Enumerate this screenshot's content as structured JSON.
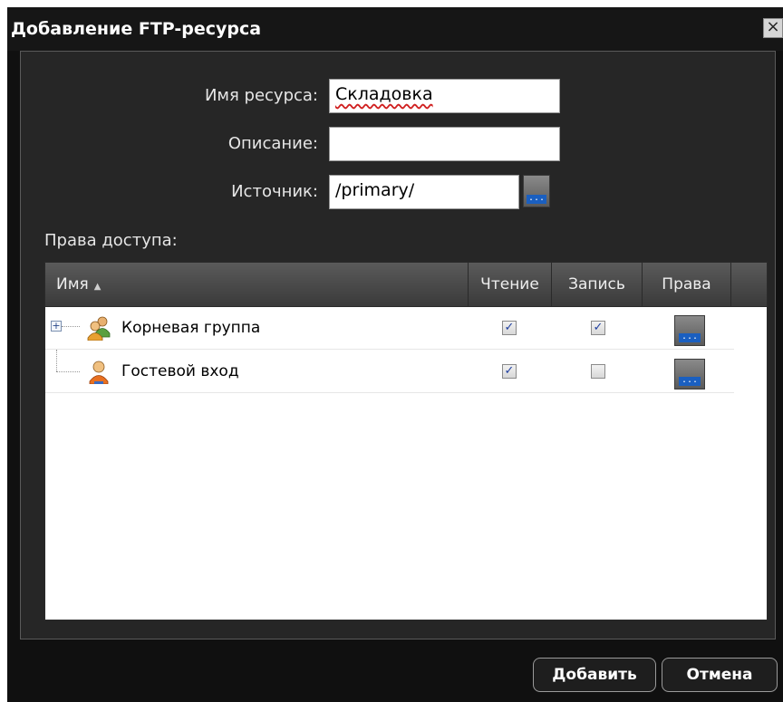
{
  "dialog": {
    "title": "Добавление FTP-ресурса",
    "close_icon": "close-icon"
  },
  "form": {
    "name_label": "Имя ресурса:",
    "name_value": "Складовка",
    "description_label": "Описание:",
    "description_value": "",
    "source_label": "Источник:",
    "source_value": "/primary/",
    "browse_icon": "browse-ellipsis-icon"
  },
  "access": {
    "section_label": "Права доступа:",
    "columns": {
      "name": "Имя",
      "read": "Чтение",
      "write": "Запись",
      "rights": "Права"
    },
    "sort_icon": "sort-ascending-icon",
    "rows": [
      {
        "name": "Корневая группа",
        "type": "group",
        "expandable": true,
        "read": true,
        "write": true
      },
      {
        "name": "Гостевой вход",
        "type": "user",
        "expandable": false,
        "read": true,
        "write": false
      }
    ]
  },
  "buttons": {
    "add": "Добавить",
    "cancel": "Отмена"
  },
  "colors": {
    "dialog_bg": "#101010",
    "panel_bg": "#262626",
    "accent_blue": "#1a5fc0"
  }
}
